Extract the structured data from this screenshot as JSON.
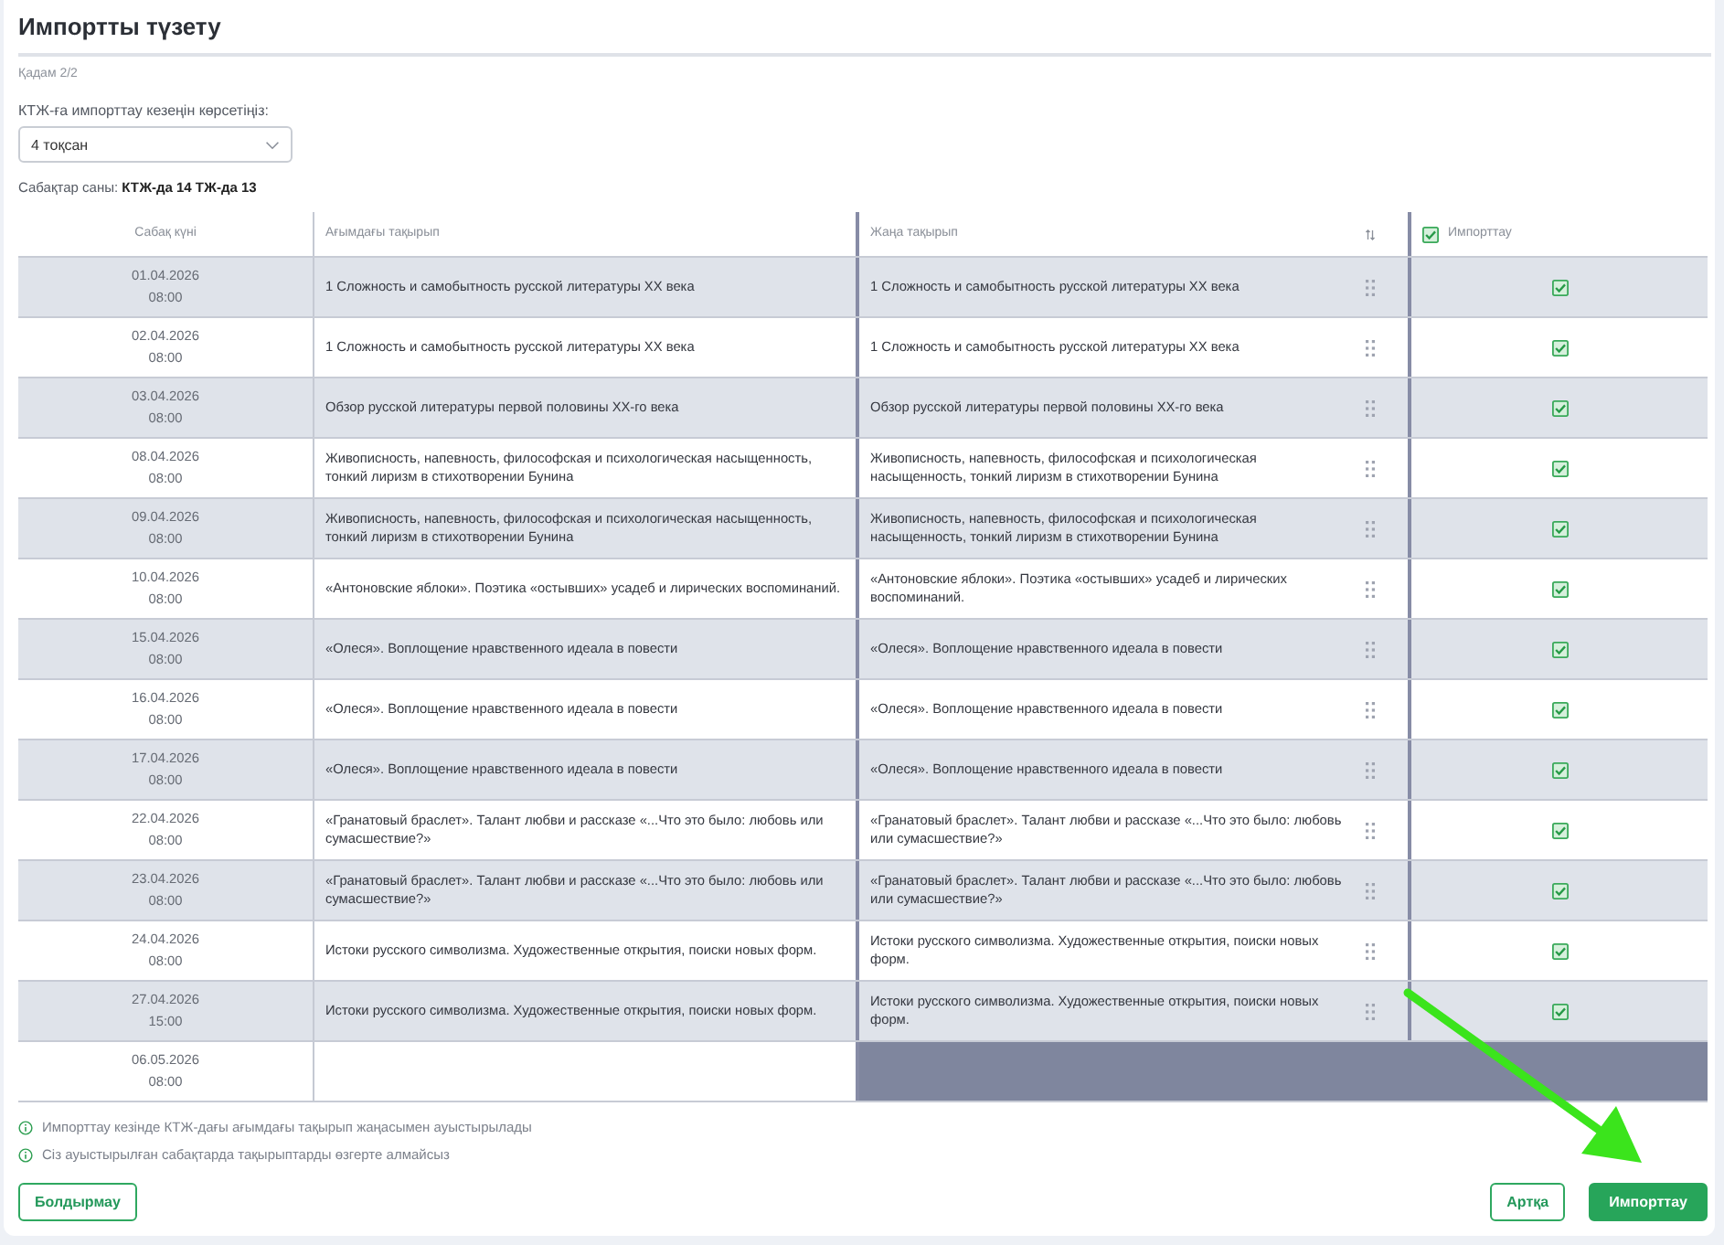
{
  "title": "Импортты түзету",
  "step": "Қадам 2/2",
  "period": {
    "label": "КТЖ-ға импорттау кезеңін көрсетіңіз:",
    "value": "4 тоқсан"
  },
  "lesson_count": "Сабақтар саны: **КТЖ-да 14 ТЖ-да 13**",
  "table": {
    "columns": [
      "Сабақ күні",
      "Ағымдағы тақырып",
      "Жаңа тақырып"
    ],
    "import_all": {
      "label": "Импорттау",
      "checked": true
    },
    "rows": [
      {
        "kind": "lesson",
        "date": "01.04.2026",
        "time": "08:00",
        "current_topic": "1 Сложность и самобытность русской литературы XX века",
        "new_topic": "1 Сложность и самобытность русской литературы XX века",
        "checked": true
      },
      {
        "kind": "lesson",
        "date": "02.04.2026",
        "time": "08:00",
        "current_topic": "1 Сложность и самобытность русской литературы XX века",
        "new_topic": "1 Сложность и самобытность русской литературы XX века",
        "checked": true
      },
      {
        "kind": "lesson",
        "date": "03.04.2026",
        "time": "08:00",
        "current_topic": "Обзор русской литературы первой половины XX-го века",
        "new_topic": "Обзор русской литературы первой половины XX-го века",
        "checked": true
      },
      {
        "kind": "lesson",
        "date": "08.04.2026",
        "time": "08:00",
        "current_topic": "Живописность, напевность, философская и психологическая насыщенность, тонкий лиризм в стихотворении Бунина",
        "new_topic": "Живописность, напевность, философская и психологическая насыщенность, тонкий лиризм в стихотворении Бунина",
        "checked": true
      },
      {
        "kind": "lesson",
        "date": "09.04.2026",
        "time": "08:00",
        "current_topic": "Живописность, напевность, философская и психологическая насыщенность, тонкий лиризм в стихотворении Бунина",
        "new_topic": "Живописность, напевность, философская и психологическая насыщенность, тонкий лиризм в стихотворении Бунина",
        "checked": true
      },
      {
        "kind": "lesson",
        "date": "10.04.2026",
        "time": "08:00",
        "current_topic": "«Антоновские яблоки». Поэтика «остывших» усадеб и лирических воспоминаний.",
        "new_topic": "«Антоновские яблоки». Поэтика «остывших» усадеб и лирических воспоминаний.",
        "checked": true
      },
      {
        "kind": "lesson",
        "date": "15.04.2026",
        "time": "08:00",
        "current_topic": "«Олеся». Воплощение нравственного идеала в повести",
        "new_topic": "«Олеся». Воплощение нравственного идеала в повести",
        "checked": true
      },
      {
        "kind": "lesson",
        "date": "16.04.2026",
        "time": "08:00",
        "current_topic": "«Олеся». Воплощение нравственного идеала в повести",
        "new_topic": "«Олеся». Воплощение нравственного идеала в повести",
        "checked": true
      },
      {
        "kind": "lesson",
        "date": "17.04.2026",
        "time": "08:00",
        "current_topic": "«Олеся». Воплощение нравственного идеала в повести",
        "new_topic": "«Олеся». Воплощение нравственного идеала в повести",
        "checked": true
      },
      {
        "kind": "lesson",
        "date": "22.04.2026",
        "time": "08:00",
        "current_topic": "«Гранатовый браслет». Талант любви и рассказе «...Что это было: любовь или сумасшествие?»",
        "new_topic": "«Гранатовый браслет». Талант любви и рассказе «...Что это было: любовь или сумасшествие?»",
        "checked": true
      },
      {
        "kind": "lesson",
        "date": "23.04.2026",
        "time": "08:00",
        "current_topic": "«Гранатовый браслет». Талант любви и рассказе «...Что это было: любовь или сумасшествие?»",
        "new_topic": "«Гранатовый браслет». Талант любви и рассказе «...Что это было: любовь или сумасшествие?»",
        "checked": true
      },
      {
        "kind": "lesson",
        "date": "24.04.2026",
        "time": "08:00",
        "current_topic": "Истоки русского символизма. Художественные открытия, поиски новых форм.",
        "new_topic": "Истоки русского символизма. Художественные открытия, поиски новых форм.",
        "checked": true
      },
      {
        "kind": "lesson",
        "date": "27.04.2026",
        "time": "15:00",
        "current_topic": "Истоки русского символизма. Художественные открытия, поиски новых форм.",
        "new_topic": "Истоки русского символизма. Художественные открытия, поиски новых форм.",
        "checked": true
      },
      {
        "kind": "unmatched",
        "date": "06.05.2026",
        "time": "08:00"
      }
    ]
  },
  "notes": [
    "Импорттау кезінде КТЖ-дағы ағымдағы тақырып жаңасымен ауыстырылады",
    "Сіз ауыстырылған сабақтарда тақырыптарды өзгерте алмайсыз"
  ],
  "footer": {
    "left_buttons": [
      {
        "label": "Болдырмау",
        "kind": "outline"
      }
    ],
    "right_buttons": [
      {
        "label": "Артқа",
        "kind": "outline"
      },
      {
        "label": "Импорттау",
        "kind": "primary"
      }
    ]
  }
}
